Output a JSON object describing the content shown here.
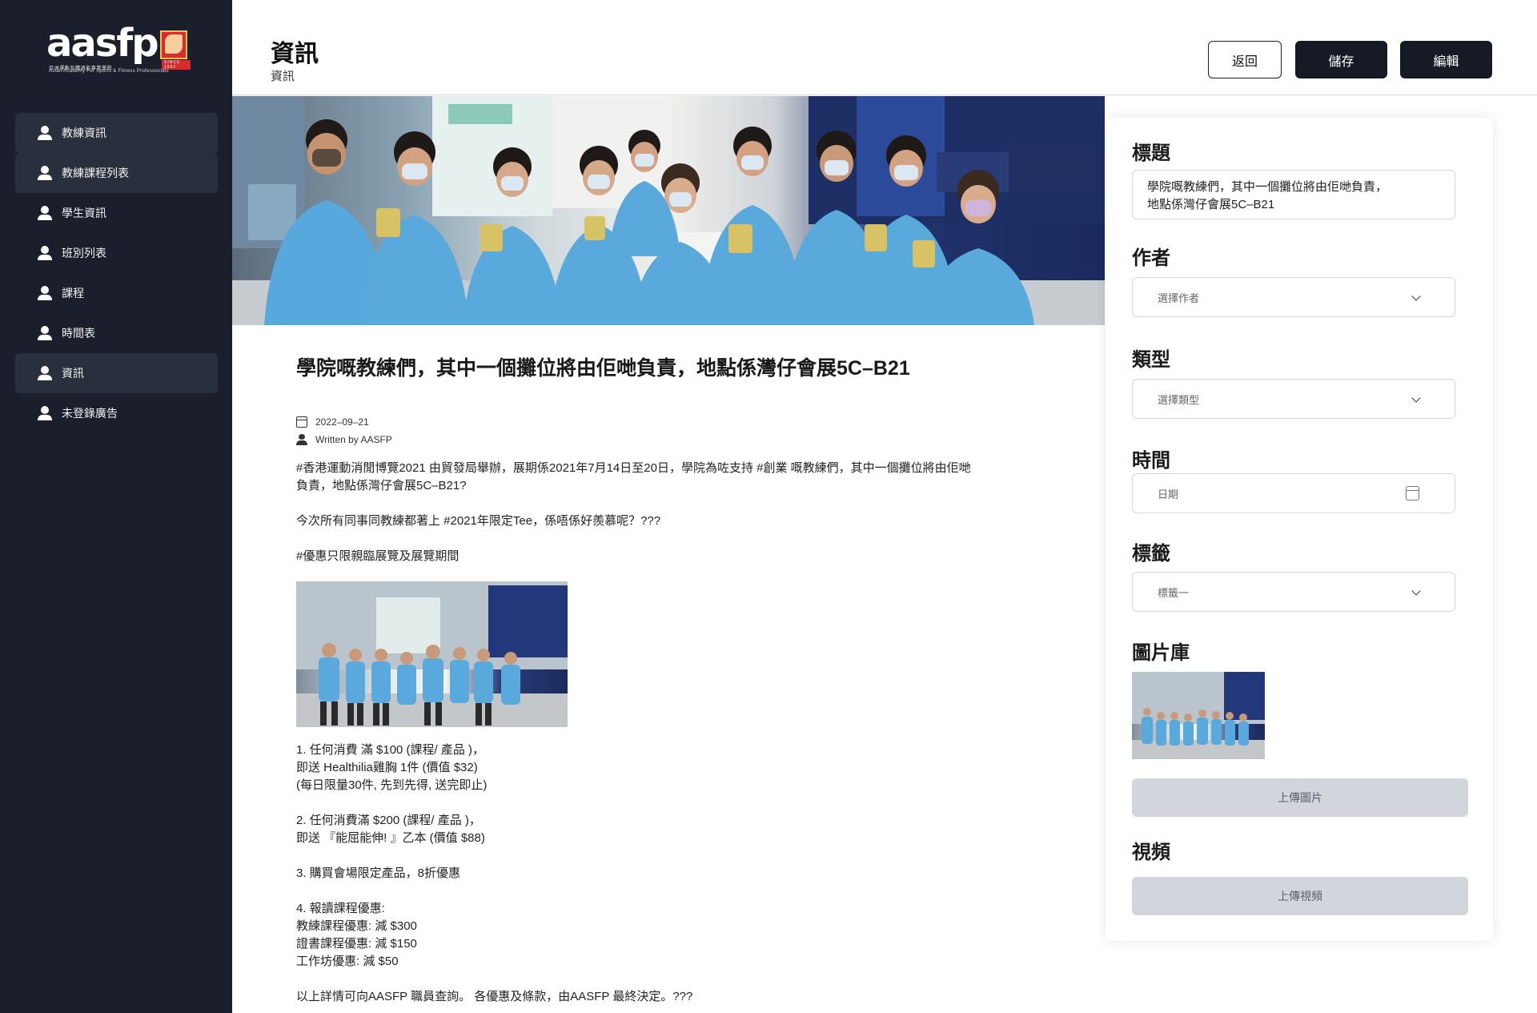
{
  "brand": {
    "name": "aasfp",
    "subtitle_zh": "亞洲運動及體適能專業學院",
    "subtitle_en": "Asian Academy For Sports & Fitness Professionals",
    "since": "SINCE 1992"
  },
  "sidebar": {
    "items": [
      {
        "label": "教練資訊",
        "icon": "user-icon",
        "active": true
      },
      {
        "label": "教練課程列表",
        "icon": "user-icon",
        "active": true
      },
      {
        "label": "學生資訊",
        "icon": "user-icon",
        "active": false
      },
      {
        "label": "班別列表",
        "icon": "user-icon",
        "active": false
      },
      {
        "label": "課程",
        "icon": "user-icon",
        "active": false
      },
      {
        "label": "時間表",
        "icon": "user-icon",
        "active": false
      },
      {
        "label": "資訊",
        "icon": "user-icon",
        "active": true
      },
      {
        "label": "未登錄廣告",
        "icon": "user-icon",
        "active": false
      }
    ]
  },
  "header": {
    "title": "資訊",
    "subtitle": "資訊",
    "back_label": "返回",
    "save_label": "儲存",
    "edit_label": "編輯"
  },
  "article": {
    "title": "學院嘅教練們，其中一個攤位將由佢哋負責，地點係灣仔會展5C–B21",
    "date": "2022–09–21",
    "written_by": "Written by  AASFP",
    "para1": "#香港運動消閒博覽2021 由貿發局舉辦，展期係2021年7月14日至20日，學院為咗支持 #創業 嘅教練們，其中一個攤位將由佢哋\n負責，地點係灣仔會展5C–B21?",
    "para2": "今次所有同事同教練都著上 #2021年限定Tee，係唔係好羨慕呢？???",
    "para3": "#優惠只限親臨展覽及展覽期間",
    "offers": "1. 任何消費 滿 $100 (課程/ 產品 )，\n即送 Healthilia雞胸 1件 (價值 $32)\n(每日限量30件, 先到先得, 送完即止)\n\n2. 任何消費滿 $200 (課程/ 產品 )，\n即送 『能屈能伸! 』乙本 (價值 $88)\n\n3. 購買會場限定產品，8折優惠\n\n4. 報讀課程優惠:\n教練課程優惠: 減 $300\n證書課程優惠: 減 $150\n工作坊優惠: 減 $50\n\n以上詳情可向AASFP 職員查詢。 各優惠及條款，由AASFP 最終決定。???"
  },
  "form": {
    "title_label": "標題",
    "title_value": "學院嘅教練們，其中一個攤位將由佢哋負責，\n地點係灣仔會展5C–B21",
    "author_label": "作者",
    "author_placeholder": "選擇作者",
    "type_label": "類型",
    "type_placeholder": "選擇類型",
    "time_label": "時間",
    "time_placeholder": "日期",
    "tag_label": "標籤",
    "tag_value": "標籤一",
    "gallery_label": "圖片庫",
    "upload_image_label": "上傳圖片",
    "video_label": "視頻",
    "upload_video_label": "上傳視頻"
  },
  "colors": {
    "sidebar_bg": "#1b1f2c",
    "primary_button": "#161a24",
    "upload_button": "#d2d5dc"
  }
}
